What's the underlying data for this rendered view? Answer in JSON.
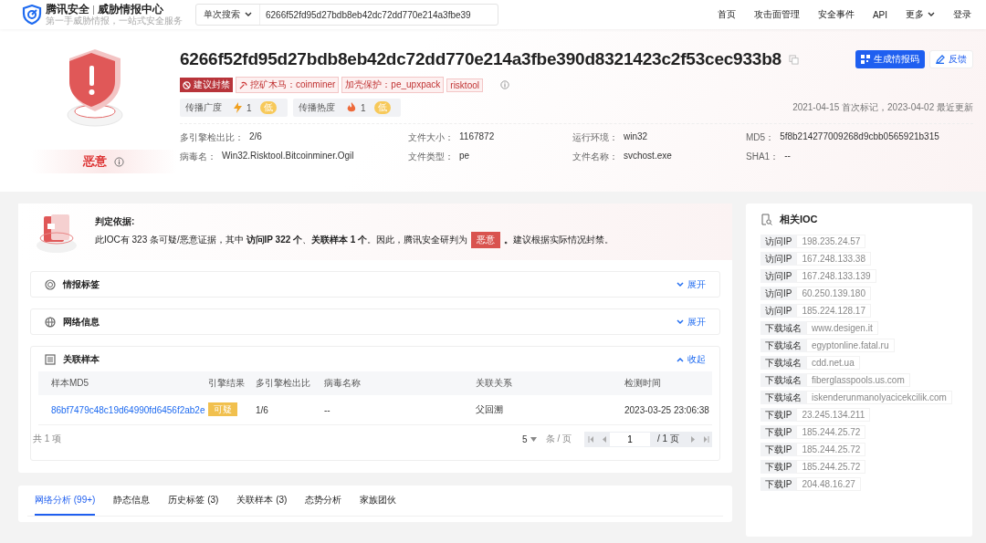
{
  "brand": {
    "name": "腾讯安全",
    "product": "威胁情报中心",
    "slogan": "第一手威胁情报，一站式安全服务"
  },
  "search": {
    "mode": "单次搜索",
    "value": "6266f52fd95d27bdb8eb42dc72dd770e214a3fbe39"
  },
  "nav": [
    "首页",
    "攻击面管理",
    "安全事件",
    "API",
    "更多",
    "登录"
  ],
  "hero": {
    "hash": "6266f52fd95d27bdb8eb42dc72dd770e214a3fbe390d8321423c2f53cec933b8",
    "verdict": "恶意",
    "buttons": [
      {
        "label": "生成情报码",
        "kind": "primary"
      },
      {
        "label": "反馈",
        "kind": "plain"
      }
    ],
    "tags": [
      {
        "label": "建议封禁",
        "kind": "block"
      },
      {
        "label": "挖矿木马：coinminer",
        "kind": "family"
      },
      {
        "label": "加壳保护：pe_upxpack",
        "kind": "plain"
      },
      {
        "label": "risktool",
        "kind": "plain"
      }
    ],
    "metrics": [
      {
        "label": "传播广度",
        "kind": "bolt",
        "value": "1",
        "rating": "低"
      },
      {
        "label": "传播热度",
        "kind": "fire",
        "value": "1",
        "rating": "低"
      }
    ],
    "dates": "2021-04-15 首次标记，2023-04-02 最近更新",
    "fields": [
      {
        "label": "多引擎检出比：",
        "value": "2/6"
      },
      {
        "label": "文件大小：",
        "value": "1167872"
      },
      {
        "label": "运行环境：",
        "value": "win32"
      },
      {
        "label": "MD5：",
        "value": "5f8b214277009268d9cbb0565921b315"
      },
      {
        "label": "病毒名：",
        "value": "Win32.Risktool.Bitcoinminer.Ogil"
      },
      {
        "label": "文件类型：",
        "value": "pe"
      },
      {
        "label": "文件名称：",
        "value": "svchost.exe"
      },
      {
        "label": "SHA1：",
        "value": "--"
      }
    ]
  },
  "judgement": {
    "title": "判定依据:",
    "before": "此IOC有 323 条可疑/恶意证据，其中 **访问IP 322 个**、**关联样本 1 个**。因此，腾讯安全研判为",
    "badge": "恶意",
    "after": "**。**建议根据实际情况封禁。"
  },
  "sections": [
    {
      "title": "情报标签",
      "expanded": false,
      "toggle": "展开"
    },
    {
      "title": "网络信息",
      "expanded": false,
      "toggle": "展开"
    },
    {
      "title": "关联样本",
      "expanded": true,
      "toggle": "收起"
    }
  ],
  "table": {
    "columns": [
      "样本MD5",
      "引擎结果",
      "多引擎检出比",
      "病毒名称",
      "关联关系",
      "检测时间"
    ],
    "rows": [
      {
        "md5": "86bf7479c48c19d64990fd6456f2ab2e",
        "result": "可疑",
        "ratio": "1/6",
        "virus": "--",
        "relation": "父回溯",
        "time": "2023-03-25 23:06:38"
      }
    ],
    "total": "共 1 项",
    "page_size": "5",
    "per_page": "条 / 页",
    "page": "1",
    "pages": "/ 1 页"
  },
  "tabs": [
    {
      "label": "网络分析 (99+)",
      "selected": true
    },
    {
      "label": "静态信息",
      "selected": false
    },
    {
      "label": "历史标签 (3)",
      "selected": false
    },
    {
      "label": "关联样本 (3)",
      "selected": false
    },
    {
      "label": "态势分析",
      "selected": false
    },
    {
      "label": "家族团伙",
      "selected": false
    }
  ],
  "ioc": {
    "title": "相关IOC",
    "items": [
      {
        "type": "访问IP",
        "value": "198.235.24.57"
      },
      {
        "type": "访问IP",
        "value": "167.248.133.38"
      },
      {
        "type": "访问IP",
        "value": "167.248.133.139"
      },
      {
        "type": "访问IP",
        "value": "60.250.139.180"
      },
      {
        "type": "访问IP",
        "value": "185.224.128.17"
      },
      {
        "type": "下载域名",
        "value": "www.desigen.it"
      },
      {
        "type": "下载域名",
        "value": "egyptonline.fatal.ru"
      },
      {
        "type": "下载域名",
        "value": "cdd.net.ua"
      },
      {
        "type": "下载域名",
        "value": "fiberglasspools.us.com"
      },
      {
        "type": "下载域名",
        "value": "iskenderunmanolyacicekcilik.com"
      },
      {
        "type": "下载IP",
        "value": "23.245.134.211"
      },
      {
        "type": "下载IP",
        "value": "185.244.25.72"
      },
      {
        "type": "下载IP",
        "value": "185.244.25.72"
      },
      {
        "type": "下载IP",
        "value": "185.244.25.72"
      },
      {
        "type": "下载IP",
        "value": "204.48.16.27"
      }
    ]
  }
}
